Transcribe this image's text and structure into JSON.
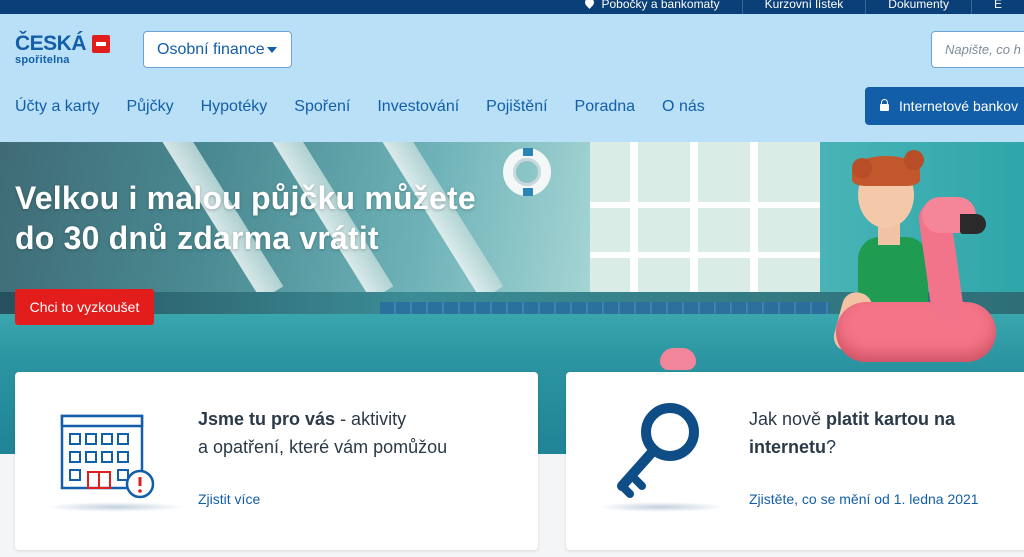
{
  "topbar": {
    "branches": "Pobočky a bankomaty",
    "rates": "Kurzovní lístek",
    "documents": "Dokumenty",
    "lang": "E"
  },
  "header": {
    "logo_main": "ČESKÁ",
    "logo_sub": "spořitelna",
    "segment_label": "Osobní finance",
    "search_placeholder": "Napište, co h",
    "nav": [
      "Účty a karty",
      "Půjčky",
      "Hypotéky",
      "Spoření",
      "Investování",
      "Pojištění",
      "Poradna",
      "O nás"
    ],
    "internet_banking": "Internetové bankov"
  },
  "hero": {
    "title_line1": "Velkou i malou půjčku můžete",
    "title_line2": "do 30 dnů zdarma vrátit",
    "cta": "Chci to vyzkoušet"
  },
  "cards": [
    {
      "bold": "Jsme tu pro vás",
      "rest_line1": " - aktivity",
      "line2": "a opatření, které vám pomůžou",
      "link": "Zjistit více"
    },
    {
      "pre": "Jak nově ",
      "bold_line1": "platit kartou na",
      "bold_line2": "internetu",
      "post": "?",
      "link": "Zjistěte, co se mění od 1. ledna 2021"
    }
  ],
  "colors": {
    "brand_blue": "#135ea8",
    "header_bg": "#b9e0f7",
    "topbar_bg": "#0a3f78",
    "cta_red": "#e31d1c"
  }
}
